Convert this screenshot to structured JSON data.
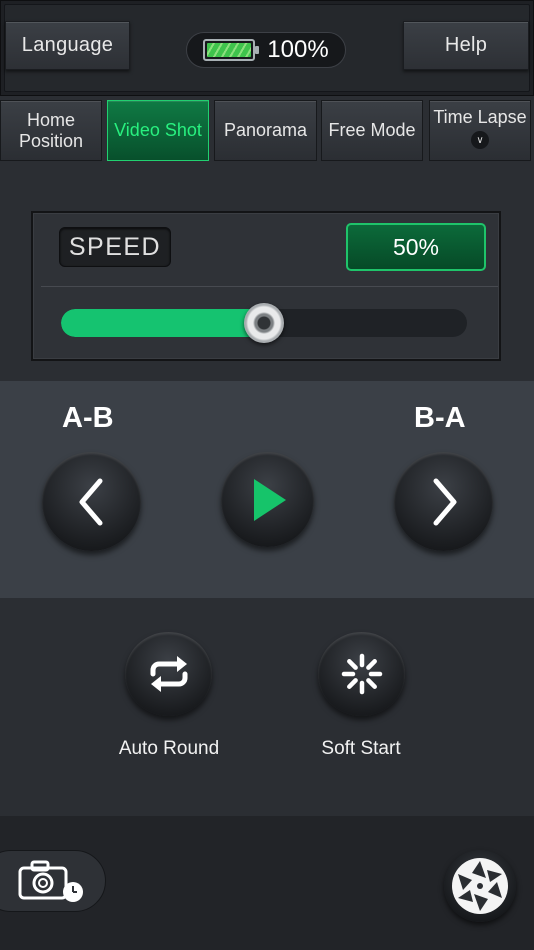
{
  "header": {
    "language_label": "Language",
    "help_label": "Help",
    "battery_text": "100%",
    "battery_level": 1.0
  },
  "tabs": [
    {
      "line1": "Home",
      "line2": "Position",
      "active": false
    },
    {
      "line1": "Video Shot",
      "active": true
    },
    {
      "line1": "Panorama",
      "active": false
    },
    {
      "line1": "Free Mode",
      "active": false
    },
    {
      "line1": "Time Lapse",
      "has_dropdown": true,
      "active": false
    }
  ],
  "speed": {
    "label": "SPEED",
    "value_text": "50%",
    "level": 0.5
  },
  "direction": {
    "left_label": "A-B",
    "right_label": "B-A",
    "left_icon": "chevron-left-icon",
    "play_icon": "play-icon",
    "right_icon": "chevron-right-icon"
  },
  "options": {
    "auto_round_label": "Auto Round",
    "soft_start_label": "Soft Start"
  },
  "colors": {
    "accent_green": "#15c370",
    "active_tab_text": "#28f07f",
    "background": "#2b2e33"
  },
  "footer": {
    "camera_icon": "camera-timer-icon",
    "shutter_icon": "shutter-aperture-icon"
  }
}
